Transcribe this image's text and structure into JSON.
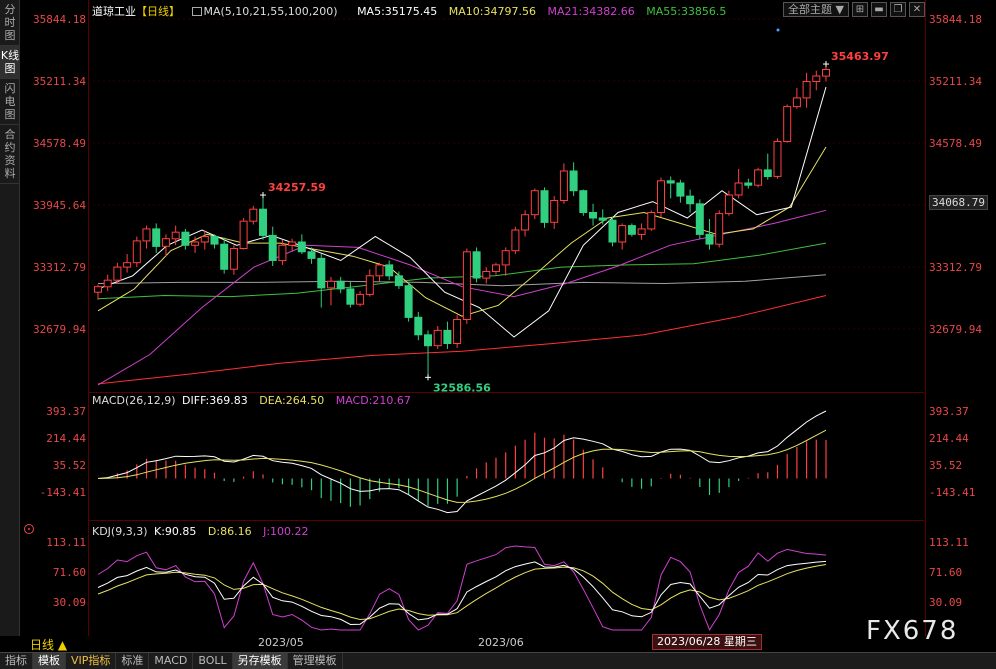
{
  "sidebar": {
    "tabs": [
      {
        "label": "分时图"
      },
      {
        "label": "K线图"
      },
      {
        "label": "闪电图"
      },
      {
        "label": "合约资料"
      }
    ]
  },
  "header": {
    "symbol": "道琼工业",
    "period_tag": "【日线】",
    "ma_config": "MA(5,10,21,55,100,200)",
    "ma5": "MA5:35175.45",
    "ma10": "MA10:34797.56",
    "ma21": "MA21:34382.66",
    "ma55": "MA55:33856.5",
    "theme_dropdown": "全部主题"
  },
  "colors": {
    "up": "#ff4040",
    "down": "#30d080",
    "ma5": "#ffffff",
    "ma10": "#e8e060",
    "ma21": "#d040d0",
    "ma55": "#40c040",
    "ma100": "#a0a0a0",
    "ma200": "#ff3030"
  },
  "main_axis": {
    "ticks": [
      "35844.18",
      "35211.34",
      "34578.49",
      "33945.64",
      "33312.79",
      "32679.94"
    ],
    "current_price": "34068.79"
  },
  "annotations": {
    "high": "35463.97",
    "mid_high": "34257.59",
    "low": "32586.56"
  },
  "macd": {
    "legend": "MACD(26,12,9)",
    "diff": "DIFF:369.83",
    "dea": "DEA:264.50",
    "macd": "MACD:210.67",
    "ticks": [
      "393.37",
      "214.44",
      "35.52",
      "-143.41"
    ]
  },
  "kdj": {
    "legend": "KDJ(9,3,3)",
    "k": "K:90.85",
    "d": "D:86.16",
    "j": "J:100.22",
    "ticks": [
      "113.11",
      "71.60",
      "30.09"
    ]
  },
  "xaxis": {
    "period_label": "日线 ▲",
    "labels": [
      "2023/05",
      "2023/06"
    ],
    "cursor_date": "2023/06/28 星期三"
  },
  "bottom_tabs": [
    "指标",
    "模板",
    "VIP指标",
    "标准",
    "MACD",
    "BOLL",
    "另存模板",
    "管理模板"
  ],
  "watermark": "FX678",
  "chart_data": {
    "type": "candlestick",
    "ohlc": [
      [
        33370,
        33440,
        33300,
        33420
      ],
      [
        33420,
        33530,
        33380,
        33480
      ],
      [
        33480,
        33640,
        33450,
        33600
      ],
      [
        33600,
        33720,
        33550,
        33640
      ],
      [
        33640,
        33880,
        33600,
        33840
      ],
      [
        33840,
        33980,
        33770,
        33950
      ],
      [
        33950,
        34000,
        33730,
        33790
      ],
      [
        33790,
        33900,
        33700,
        33860
      ],
      [
        33860,
        33980,
        33800,
        33920
      ],
      [
        33920,
        33950,
        33760,
        33800
      ],
      [
        33800,
        33880,
        33730,
        33830
      ],
      [
        33830,
        33930,
        33760,
        33880
      ],
      [
        33880,
        33900,
        33770,
        33810
      ],
      [
        33810,
        33870,
        33540,
        33580
      ],
      [
        33580,
        33800,
        33530,
        33770
      ],
      [
        33770,
        34050,
        33760,
        34020
      ],
      [
        34020,
        34160,
        33990,
        34130
      ],
      [
        34130,
        34260,
        33850,
        33890
      ],
      [
        33890,
        33970,
        33610,
        33660
      ],
      [
        33660,
        33850,
        33620,
        33800
      ],
      [
        33800,
        33860,
        33740,
        33830
      ],
      [
        33830,
        33900,
        33720,
        33740
      ],
      [
        33740,
        33780,
        33630,
        33680
      ],
      [
        33680,
        33720,
        33230,
        33410
      ],
      [
        33410,
        33510,
        33250,
        33470
      ],
      [
        33470,
        33510,
        33360,
        33400
      ],
      [
        33400,
        33470,
        33230,
        33260
      ],
      [
        33260,
        33380,
        33240,
        33350
      ],
      [
        33350,
        33580,
        33330,
        33520
      ],
      [
        33520,
        33640,
        33470,
        33620
      ],
      [
        33620,
        33660,
        33480,
        33520
      ],
      [
        33520,
        33560,
        33400,
        33430
      ],
      [
        33430,
        33460,
        33100,
        33140
      ],
      [
        33140,
        33190,
        32930,
        32980
      ],
      [
        32980,
        33020,
        32590,
        32880
      ],
      [
        32880,
        33060,
        32850,
        33020
      ],
      [
        33020,
        33100,
        32850,
        32900
      ],
      [
        32900,
        33160,
        32860,
        33120
      ],
      [
        33120,
        33770,
        33080,
        33740
      ],
      [
        33740,
        33780,
        33460,
        33500
      ],
      [
        33500,
        33600,
        33450,
        33560
      ],
      [
        33560,
        33640,
        33530,
        33620
      ],
      [
        33620,
        33780,
        33520,
        33750
      ],
      [
        33750,
        33970,
        33720,
        33940
      ],
      [
        33940,
        34120,
        33880,
        34080
      ],
      [
        34080,
        34320,
        34040,
        34300
      ],
      [
        34300,
        34330,
        33960,
        34010
      ],
      [
        34010,
        34250,
        33950,
        34210
      ],
      [
        34210,
        34550,
        34180,
        34480
      ],
      [
        34480,
        34560,
        34250,
        34300
      ],
      [
        34300,
        34310,
        34070,
        34100
      ],
      [
        34100,
        34180,
        33980,
        34050
      ],
      [
        34050,
        34130,
        33990,
        34030
      ],
      [
        34030,
        34060,
        33790,
        33830
      ],
      [
        33830,
        34000,
        33760,
        33980
      ],
      [
        33980,
        34000,
        33880,
        33900
      ],
      [
        33900,
        34000,
        33850,
        33950
      ],
      [
        33950,
        34120,
        33930,
        34100
      ],
      [
        34100,
        34420,
        34060,
        34390
      ],
      [
        34390,
        34430,
        34230,
        34370
      ],
      [
        34370,
        34400,
        34190,
        34250
      ],
      [
        34250,
        34310,
        34100,
        34180
      ],
      [
        34180,
        34220,
        33860,
        33900
      ],
      [
        33900,
        34040,
        33760,
        33810
      ],
      [
        33810,
        34120,
        33780,
        34090
      ],
      [
        34090,
        34300,
        34070,
        34260
      ],
      [
        34260,
        34500,
        34230,
        34370
      ],
      [
        34370,
        34410,
        34320,
        34350
      ],
      [
        34350,
        34510,
        34330,
        34490
      ],
      [
        34490,
        34640,
        34400,
        34430
      ],
      [
        34430,
        34780,
        34410,
        34750
      ],
      [
        34750,
        35090,
        34740,
        35070
      ],
      [
        35070,
        35240,
        35050,
        35150
      ],
      [
        35150,
        35380,
        35060,
        35300
      ],
      [
        35300,
        35400,
        35220,
        35350
      ],
      [
        35350,
        35460,
        35300,
        35410
      ]
    ],
    "ma5_anchor": [
      33400,
      33520,
      33800,
      33940,
      33800,
      33890,
      33780,
      33660,
      33880,
      33690,
      33370,
      33230,
      32960,
      33200,
      33800,
      34100,
      34200,
      34050,
      34300,
      34080,
      34150,
      35250
    ],
    "ma10_anchor": [
      33200,
      33400,
      33750,
      33900,
      33820,
      33820,
      33760,
      33700,
      33600,
      33320,
      33150,
      33250,
      33530,
      33820,
      34050,
      34100,
      34000,
      33900,
      33950,
      34150,
      34700
    ],
    "ma21_anchor": [
      32520,
      32800,
      33230,
      33600,
      33800,
      33780,
      33620,
      33420,
      33330,
      33450,
      33610,
      33800,
      33900,
      34000,
      34120
    ],
    "ma55_anchor": [
      33310,
      33340,
      33330,
      33360,
      33430,
      33500,
      33520,
      33600,
      33620,
      33630,
      33710,
      33820
    ],
    "ma100_anchor": [
      33450,
      33460,
      33460,
      33470,
      33460,
      33430,
      33460,
      33450,
      33470,
      33530
    ],
    "ma200_anchor": [
      32530,
      32620,
      32720,
      32790,
      32830,
      32900,
      32980,
      33140,
      33340
    ],
    "ylim": [
      32520,
      35900
    ],
    "macd": {
      "ylim": [
        -200,
        430
      ],
      "diff_end": 369.83,
      "dea_end": 264.5,
      "macd_end": 210.67
    },
    "kdj": {
      "ylim": [
        10,
        120
      ],
      "k_end": 90.85,
      "d_end": 86.16,
      "j_end": 100.22
    },
    "xlabels": [
      "2023/05",
      "2023/06"
    ]
  }
}
